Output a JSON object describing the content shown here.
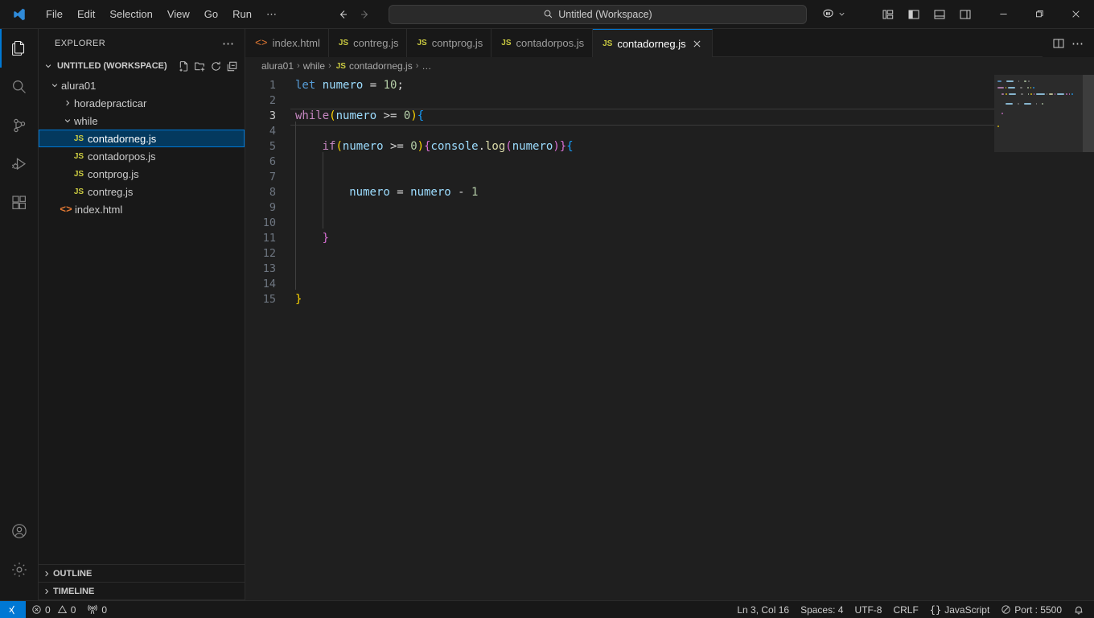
{
  "titlebar": {
    "logo_icon": "vscode-logo-icon",
    "menus": [
      "File",
      "Edit",
      "Selection",
      "View",
      "Go",
      "Run",
      "⋯"
    ],
    "back_icon": "arrow-left-icon",
    "forward_icon": "arrow-right-icon",
    "command_center": {
      "search_icon": "search-icon",
      "text": "Untitled (Workspace)"
    },
    "live_share": {
      "icon": "live-share-icon",
      "chevron": "chevron-down-icon"
    },
    "layout_buttons": [
      {
        "name": "customize-layout-icon",
        "title": "Customize Layout"
      },
      {
        "name": "toggle-primary-sidebar-icon",
        "title": "Toggle Primary Side Bar"
      },
      {
        "name": "toggle-panel-icon",
        "title": "Toggle Panel"
      },
      {
        "name": "toggle-secondary-sidebar-icon",
        "title": "Toggle Secondary Side Bar"
      }
    ],
    "window_buttons": [
      {
        "name": "minimize-button",
        "glyph": "─"
      },
      {
        "name": "maximize-button",
        "glyph": "❐"
      },
      {
        "name": "close-button",
        "glyph": "✕"
      }
    ]
  },
  "activitybar": {
    "items": [
      {
        "name": "explorer",
        "icon": "files-icon",
        "active": true
      },
      {
        "name": "search",
        "icon": "search-icon",
        "active": false
      },
      {
        "name": "source-control",
        "icon": "source-control-icon",
        "active": false
      },
      {
        "name": "run-and-debug",
        "icon": "run-debug-icon",
        "active": false
      },
      {
        "name": "extensions",
        "icon": "extensions-icon",
        "active": false
      }
    ],
    "bottom": [
      {
        "name": "accounts",
        "icon": "account-icon"
      },
      {
        "name": "manage",
        "icon": "gear-icon"
      }
    ]
  },
  "sidebar": {
    "title": "EXPLORER",
    "more_actions": "⋯",
    "workspace": {
      "label": "UNTITLED (WORKSPACE)",
      "actions": [
        "new-file-icon",
        "new-folder-icon",
        "refresh-icon",
        "collapse-all-icon"
      ]
    },
    "tree": [
      {
        "label": "alura01",
        "type": "folder",
        "indent": 1,
        "expanded": true,
        "selected": false
      },
      {
        "label": "horadepracticar",
        "type": "folder",
        "indent": 2,
        "expanded": false,
        "selected": false
      },
      {
        "label": "while",
        "type": "folder",
        "indent": 2,
        "expanded": true,
        "selected": false
      },
      {
        "label": "contadorneg.js",
        "type": "js",
        "indent": 3,
        "selected": true
      },
      {
        "label": "contadorpos.js",
        "type": "js",
        "indent": 3,
        "selected": false
      },
      {
        "label": "contprog.js",
        "type": "js",
        "indent": 3,
        "selected": false
      },
      {
        "label": "contreg.js",
        "type": "js",
        "indent": 3,
        "selected": false
      },
      {
        "label": "index.html",
        "type": "html",
        "indent": 2,
        "selected": false
      }
    ],
    "bottom_sections": [
      "OUTLINE",
      "TIMELINE"
    ]
  },
  "editor": {
    "tabs": [
      {
        "label": "index.html",
        "type": "html",
        "active": false,
        "closable": false
      },
      {
        "label": "contreg.js",
        "type": "js",
        "active": false,
        "closable": false
      },
      {
        "label": "contprog.js",
        "type": "js",
        "active": false,
        "closable": false
      },
      {
        "label": "contadorpos.js",
        "type": "js",
        "active": false,
        "closable": false
      },
      {
        "label": "contadorneg.js",
        "type": "js",
        "active": true,
        "closable": true
      }
    ],
    "tab_actions": [
      {
        "name": "split-editor-right-icon"
      },
      {
        "name": "more-actions-icon",
        "glyph": "⋯"
      }
    ],
    "breadcrumbs": [
      "alura01",
      "while",
      "contadorneg.js",
      "…"
    ],
    "breadcrumb_file_icon": "js-icon",
    "current_line": 3,
    "lines": [
      {
        "n": 1,
        "indent": 0,
        "tokens": [
          {
            "t": "let",
            "c": "t-kw"
          },
          {
            "t": " ",
            "c": "t-op"
          },
          {
            "t": "numero",
            "c": "t-var"
          },
          {
            "t": " ",
            "c": "t-op"
          },
          {
            "t": "=",
            "c": "t-op"
          },
          {
            "t": " ",
            "c": "t-op"
          },
          {
            "t": "10",
            "c": "t-num"
          },
          {
            "t": ";",
            "c": "t-pl"
          }
        ]
      },
      {
        "n": 2,
        "indent": 0,
        "tokens": []
      },
      {
        "n": 3,
        "indent": 0,
        "tokens": [
          {
            "t": "while",
            "c": "t-ctl"
          },
          {
            "t": "(",
            "c": "t-p1"
          },
          {
            "t": "numero",
            "c": "t-var"
          },
          {
            "t": " ",
            "c": "t-op"
          },
          {
            "t": ">=",
            "c": "t-op"
          },
          {
            "t": " ",
            "c": "t-op"
          },
          {
            "t": "0",
            "c": "t-num"
          },
          {
            "t": ")",
            "c": "t-p1"
          },
          {
            "t": "{",
            "c": "t-p3"
          }
        ]
      },
      {
        "n": 4,
        "indent": 1,
        "tokens": []
      },
      {
        "n": 5,
        "indent": 1,
        "tokens": [
          {
            "t": "if",
            "c": "t-ctl"
          },
          {
            "t": "(",
            "c": "t-p1"
          },
          {
            "t": "numero",
            "c": "t-var"
          },
          {
            "t": " ",
            "c": "t-op"
          },
          {
            "t": ">=",
            "c": "t-op"
          },
          {
            "t": " ",
            "c": "t-op"
          },
          {
            "t": "0",
            "c": "t-num"
          },
          {
            "t": ")",
            "c": "t-p1"
          },
          {
            "t": "{",
            "c": "t-p2"
          },
          {
            "t": "console",
            "c": "t-var"
          },
          {
            "t": ".",
            "c": "t-pl"
          },
          {
            "t": "log",
            "c": "t-fn"
          },
          {
            "t": "(",
            "c": "t-p2"
          },
          {
            "t": "numero",
            "c": "t-var"
          },
          {
            "t": ")",
            "c": "t-p2"
          },
          {
            "t": "}",
            "c": "t-p2"
          },
          {
            "t": "{",
            "c": "t-p3"
          }
        ]
      },
      {
        "n": 6,
        "indent": 2,
        "tokens": []
      },
      {
        "n": 7,
        "indent": 2,
        "tokens": []
      },
      {
        "n": 8,
        "indent": 2,
        "tokens": [
          {
            "t": "numero",
            "c": "t-var"
          },
          {
            "t": " ",
            "c": "t-op"
          },
          {
            "t": "=",
            "c": "t-op"
          },
          {
            "t": " ",
            "c": "t-op"
          },
          {
            "t": "numero",
            "c": "t-var"
          },
          {
            "t": " ",
            "c": "t-op"
          },
          {
            "t": "-",
            "c": "t-op"
          },
          {
            "t": " ",
            "c": "t-op"
          },
          {
            "t": "1",
            "c": "t-num"
          }
        ]
      },
      {
        "n": 9,
        "indent": 2,
        "tokens": []
      },
      {
        "n": 10,
        "indent": 2,
        "tokens": []
      },
      {
        "n": 11,
        "indent": 1,
        "tokens": [
          {
            "t": "}",
            "c": "t-p2"
          }
        ]
      },
      {
        "n": 12,
        "indent": 1,
        "tokens": []
      },
      {
        "n": 13,
        "indent": 1,
        "tokens": []
      },
      {
        "n": 14,
        "indent": 1,
        "tokens": []
      },
      {
        "n": 15,
        "indent": 0,
        "tokens": [
          {
            "t": "}",
            "c": "t-p1"
          }
        ]
      }
    ]
  },
  "statusbar": {
    "remote": {
      "icon": "remote-icon",
      "label": ""
    },
    "left": [
      {
        "name": "problems-errors",
        "icon": "error-icon",
        "label": "0"
      },
      {
        "name": "problems-warnings",
        "icon": "warning-icon",
        "label": "0"
      },
      {
        "name": "ports",
        "icon": "radio-tower-icon",
        "label": "0"
      }
    ],
    "right": [
      {
        "name": "editor-position",
        "label": "Ln 3, Col 16"
      },
      {
        "name": "editor-indentation",
        "label": "Spaces: 4"
      },
      {
        "name": "editor-encoding",
        "label": "UTF-8"
      },
      {
        "name": "editor-eol",
        "label": "CRLF"
      },
      {
        "name": "editor-language",
        "label": "JavaScript",
        "icon": "braces-icon"
      },
      {
        "name": "live-server-port",
        "label": "Port : 5500",
        "icon": "circle-slash-icon"
      },
      {
        "name": "notifications",
        "label": "",
        "icon": "bell-icon"
      }
    ]
  },
  "colors": {
    "accent": "#0078d4",
    "titlebar_bg": "#181818",
    "editor_bg": "#1f1f1f",
    "sidebar_bg": "#181818",
    "selection_bg": "#04395e",
    "js_icon": "#cbcb41",
    "html_icon": "#e37933"
  }
}
